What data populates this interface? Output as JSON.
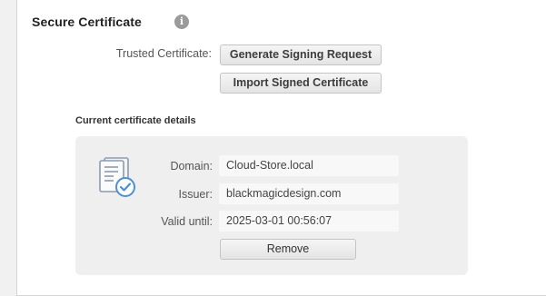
{
  "section": {
    "title": "Secure Certificate",
    "info_icon": "info-icon",
    "info_glyph": "i"
  },
  "trusted": {
    "label": "Trusted Certificate:",
    "generate_label": "Generate Signing Request",
    "import_label": "Import Signed Certificate"
  },
  "details": {
    "heading": "Current certificate details",
    "icon": "certificate-icon",
    "accent_color": "#4a90d9",
    "fields": [
      {
        "label": "Domain:",
        "value": "Cloud-Store.local"
      },
      {
        "label": "Issuer:",
        "value": "blackmagicdesign.com"
      },
      {
        "label": "Valid until:",
        "value": "2025-03-01 00:56:07"
      }
    ],
    "remove_label": "Remove"
  }
}
